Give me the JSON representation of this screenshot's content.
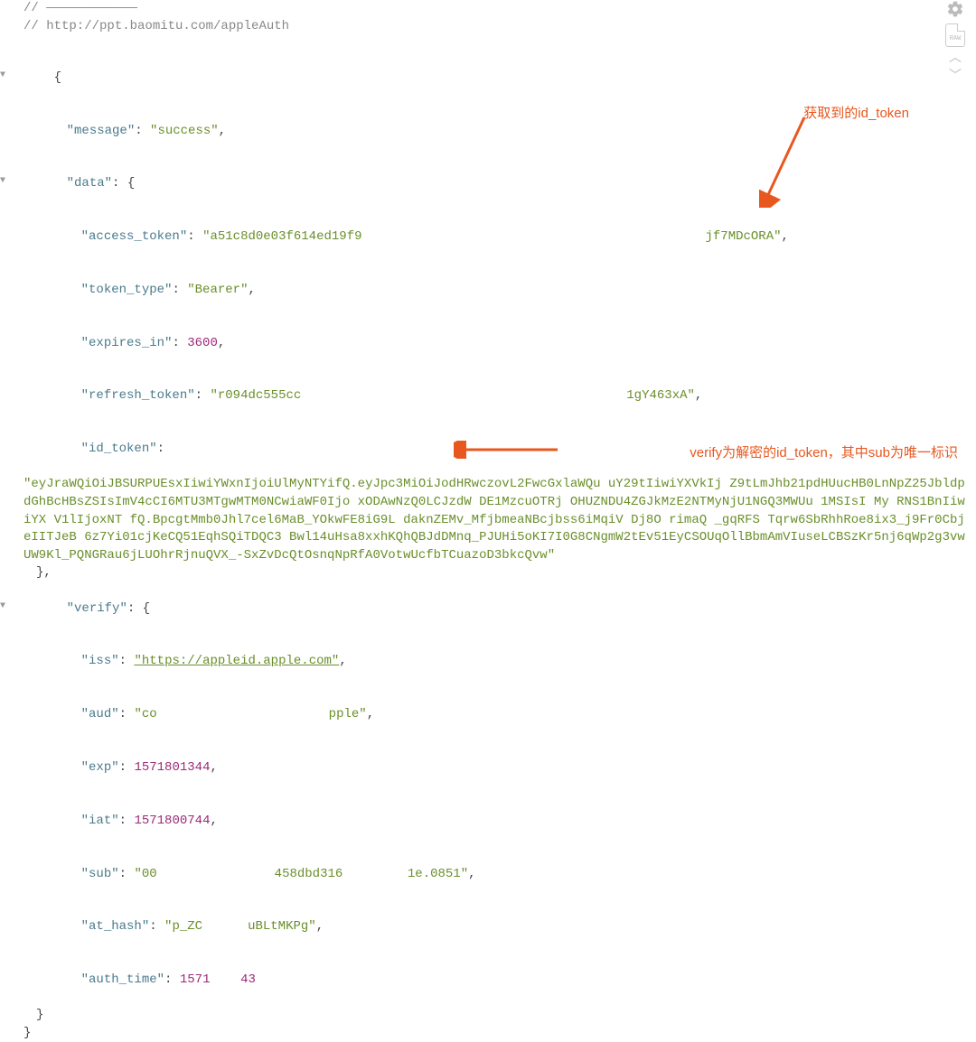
{
  "comments": {
    "line1": "// ————————————",
    "line2": "// http://ppt.baomitu.com/appleAuth"
  },
  "json": {
    "message": "success",
    "data": {
      "access_token": "a51c8d0e03f614ed19f9",
      "access_token_suffix": "jf7MDcORA",
      "token_type": "Bearer",
      "expires_in": "3600",
      "refresh_token_prefix": "r094dc555cc",
      "refresh_token_suffix": "1gY463xA",
      "id_token": "eyJraWQiOiJBSURPUEsxIiwiYWxnIjoiUlMyNTYifQ.eyJpc3MiOiJodHRwczovL2FwcGxlaWQu    uY29tIiwiYXVkIj    Z9tLmJhb21pdHUucHB0LnNpZ25JbldpdGhBcHBsZSIsImV4cCI6MTU3MTgwMTM0NCwiaWF0Ijo    xODAwNzQ0LCJzdW    DE1MzcuOTRj    OHUZNDU4ZGJkMzE2NTMyNjU1NGQ3MWUu    1MSIsI    My    RNS1BnIiwiYX    V1lIjoxNT    fQ.BpcgtMmb0Jhl7cel6MaB_YOkwFE8iG9L   daknZEMv_MfjbmeaNBcjbss6iMqiV   Dj8O             rimaQ      _gqRFS    Tqrw6SbRhhRoe8ix3_j9Fr0CbjeIITJeB    6z7Yi01cjKeCQ51EqhSQiTDQC3 Bwl14uHsa8xxhKQhQBJdDMnq_PJUHi5oKI7I0G8CNgmW2tEv51EyCSOUqOllBbmAmVIuseLCBSzKr5nj6qWp2g3vwUW9Kl_PQNGRau6jLUOhrRjnuQVX_-SxZvDcQtOsnqNpRfA0VotwUcfbTCuazoD3bkcQvw"
    },
    "verify": {
      "iss": "https://appleid.apple.com",
      "aud_prefix": "co",
      "aud_suffix": "pple",
      "exp": "1571801344",
      "iat": "1571800744",
      "sub_prefix": "00",
      "sub_mid": "458dbd316    ",
      "sub_suffix": "1e.0851",
      "at_hash_prefix": "p_ZC",
      "at_hash_suffix": "uBLtMKPg",
      "auth_time": "1571    43"
    }
  },
  "annotations": {
    "anno1": "获取到的id_token",
    "anno2": "verify为解密的id_token，其中sub为唯一标识"
  },
  "toolbar": {
    "raw_label": "RAW"
  }
}
